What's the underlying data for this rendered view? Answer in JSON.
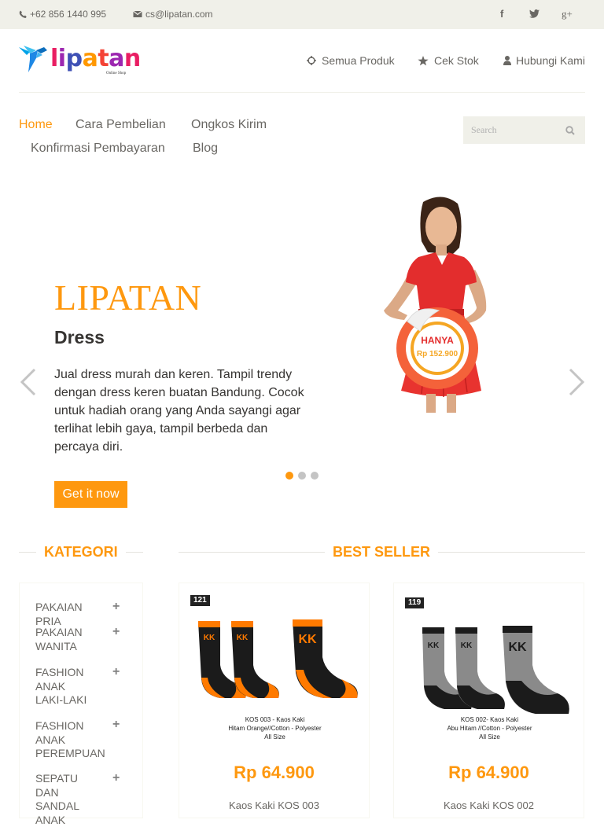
{
  "topbar": {
    "phone": "+62 856 1440 995",
    "email": "cs@lipatan.com",
    "social": [
      "facebook-icon",
      "twitter-icon",
      "google-plus-icon"
    ],
    "social_glyphs": [
      "f",
      "t",
      "g+"
    ]
  },
  "logo": {
    "text": "lipatan",
    "tagline": "Online Shop"
  },
  "header_nav": [
    {
      "label": "Semua Produk",
      "icon": "crosshair-icon"
    },
    {
      "label": "Cek Stok",
      "icon": "star-icon"
    },
    {
      "label": "Hubungi Kami",
      "icon": "user-icon"
    }
  ],
  "main_nav": [
    "Home",
    "Cara Pembelian",
    "Ongkos Kirim",
    "Konfirmasi Pembayaran",
    "Blog"
  ],
  "search": {
    "placeholder": "Search"
  },
  "slider": {
    "brand": "LIPATAN",
    "title": "Dress",
    "description": "Jual dress murah dan keren. Tampil trendy dengan dress keren buatan Bandung. Cocok untuk hadiah orang yang Anda sayangi agar terlihat lebih gaya, tampil berbeda dan percaya diri.",
    "button": "Get it now",
    "sticker_label": "HANYA",
    "sticker_price": "Rp 152.900",
    "active_index": 0,
    "slide_count": 3
  },
  "sections": {
    "category_title": "KATEGORI",
    "bestseller_title": "BEST SELLER"
  },
  "categories": [
    {
      "label": "PAKAIAN PRIA"
    },
    {
      "label": "PAKAIAN WANITA"
    },
    {
      "label": "FASHION ANAK LAKI-LAKI"
    },
    {
      "label": "FASHION ANAK PEREMPUAN"
    },
    {
      "label": "SEPATU DAN SANDAL ANAK"
    }
  ],
  "products": [
    {
      "badge": "121",
      "name_line1": "KOS 003 - Kaos Kaki",
      "name_line2": "Hitam Orange//Cotton - Polyester",
      "name_line3": "All Size",
      "sock_brand": "KK",
      "price": "Rp 64.900",
      "code": "Kaos Kaki KOS 003"
    },
    {
      "badge": "119",
      "name_line1": "KOS 002- Kaos Kaki",
      "name_line2": "Abu Hitam //Cotton - Polyester",
      "name_line3": "All Size",
      "sock_brand": "KK",
      "price": "Rp 64.900",
      "code": "Kaos Kaki KOS 002"
    }
  ],
  "colors": {
    "accent": "#fe980f",
    "topbar_bg": "#f0f0e9",
    "text": "#696763",
    "dark_text": "#363432",
    "dress_red": "#e32d2d"
  }
}
